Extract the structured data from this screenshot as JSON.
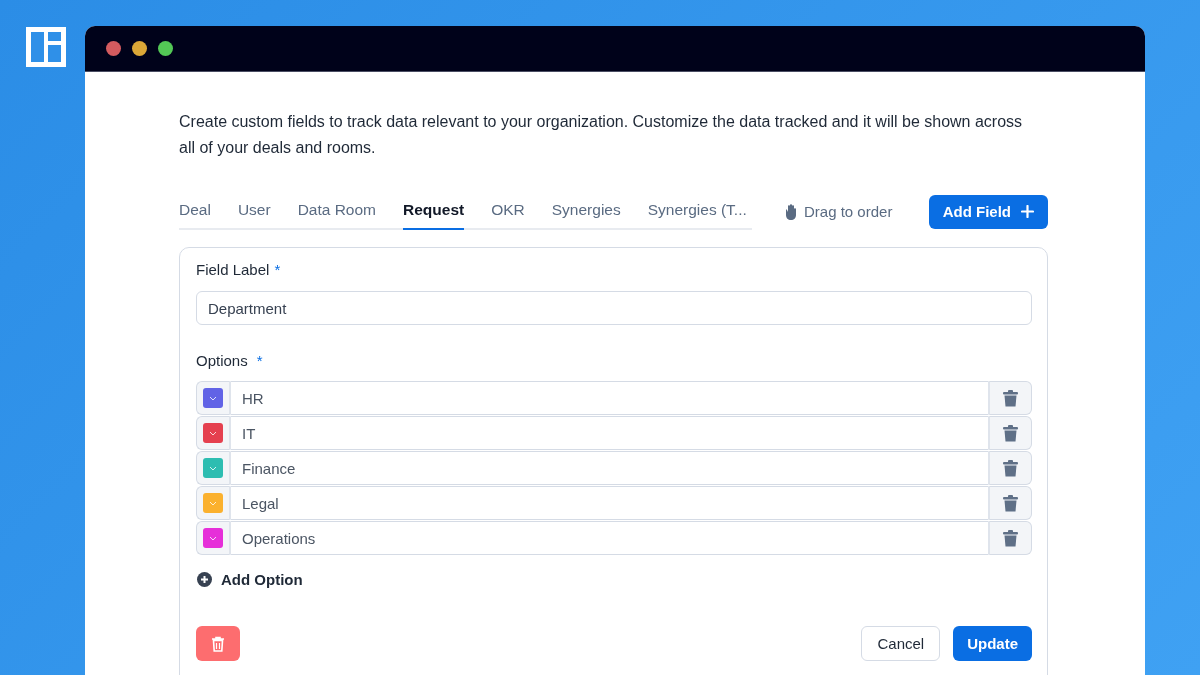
{
  "description": "Create custom fields to track data relevant to your organization. Customize the data tracked and it will be shown across all of your deals and rooms.",
  "tabs": [
    {
      "label": "Deal",
      "selected": false
    },
    {
      "label": "User",
      "selected": false
    },
    {
      "label": "Data Room",
      "selected": false
    },
    {
      "label": "Request",
      "selected": true
    },
    {
      "label": "OKR",
      "selected": false
    },
    {
      "label": "Synergies",
      "selected": false
    },
    {
      "label": "Synergies (T...",
      "selected": false
    }
  ],
  "drag_hint": "Drag to order",
  "add_field_button": "Add Field",
  "form": {
    "field_label": {
      "label": "Field Label",
      "required_mark": "*",
      "value": "Department"
    },
    "options": {
      "label": "Options",
      "required_mark": "*",
      "items": [
        {
          "label": "HR",
          "color": "#6163e6"
        },
        {
          "label": "IT",
          "color": "#e5404f"
        },
        {
          "label": "Finance",
          "color": "#2dbdb1"
        },
        {
          "label": "Legal",
          "color": "#fbb12e"
        },
        {
          "label": "Operations",
          "color": "#e62fd9"
        }
      ]
    },
    "add_option": "Add Option",
    "cancel_button": "Cancel",
    "update_button": "Update"
  }
}
